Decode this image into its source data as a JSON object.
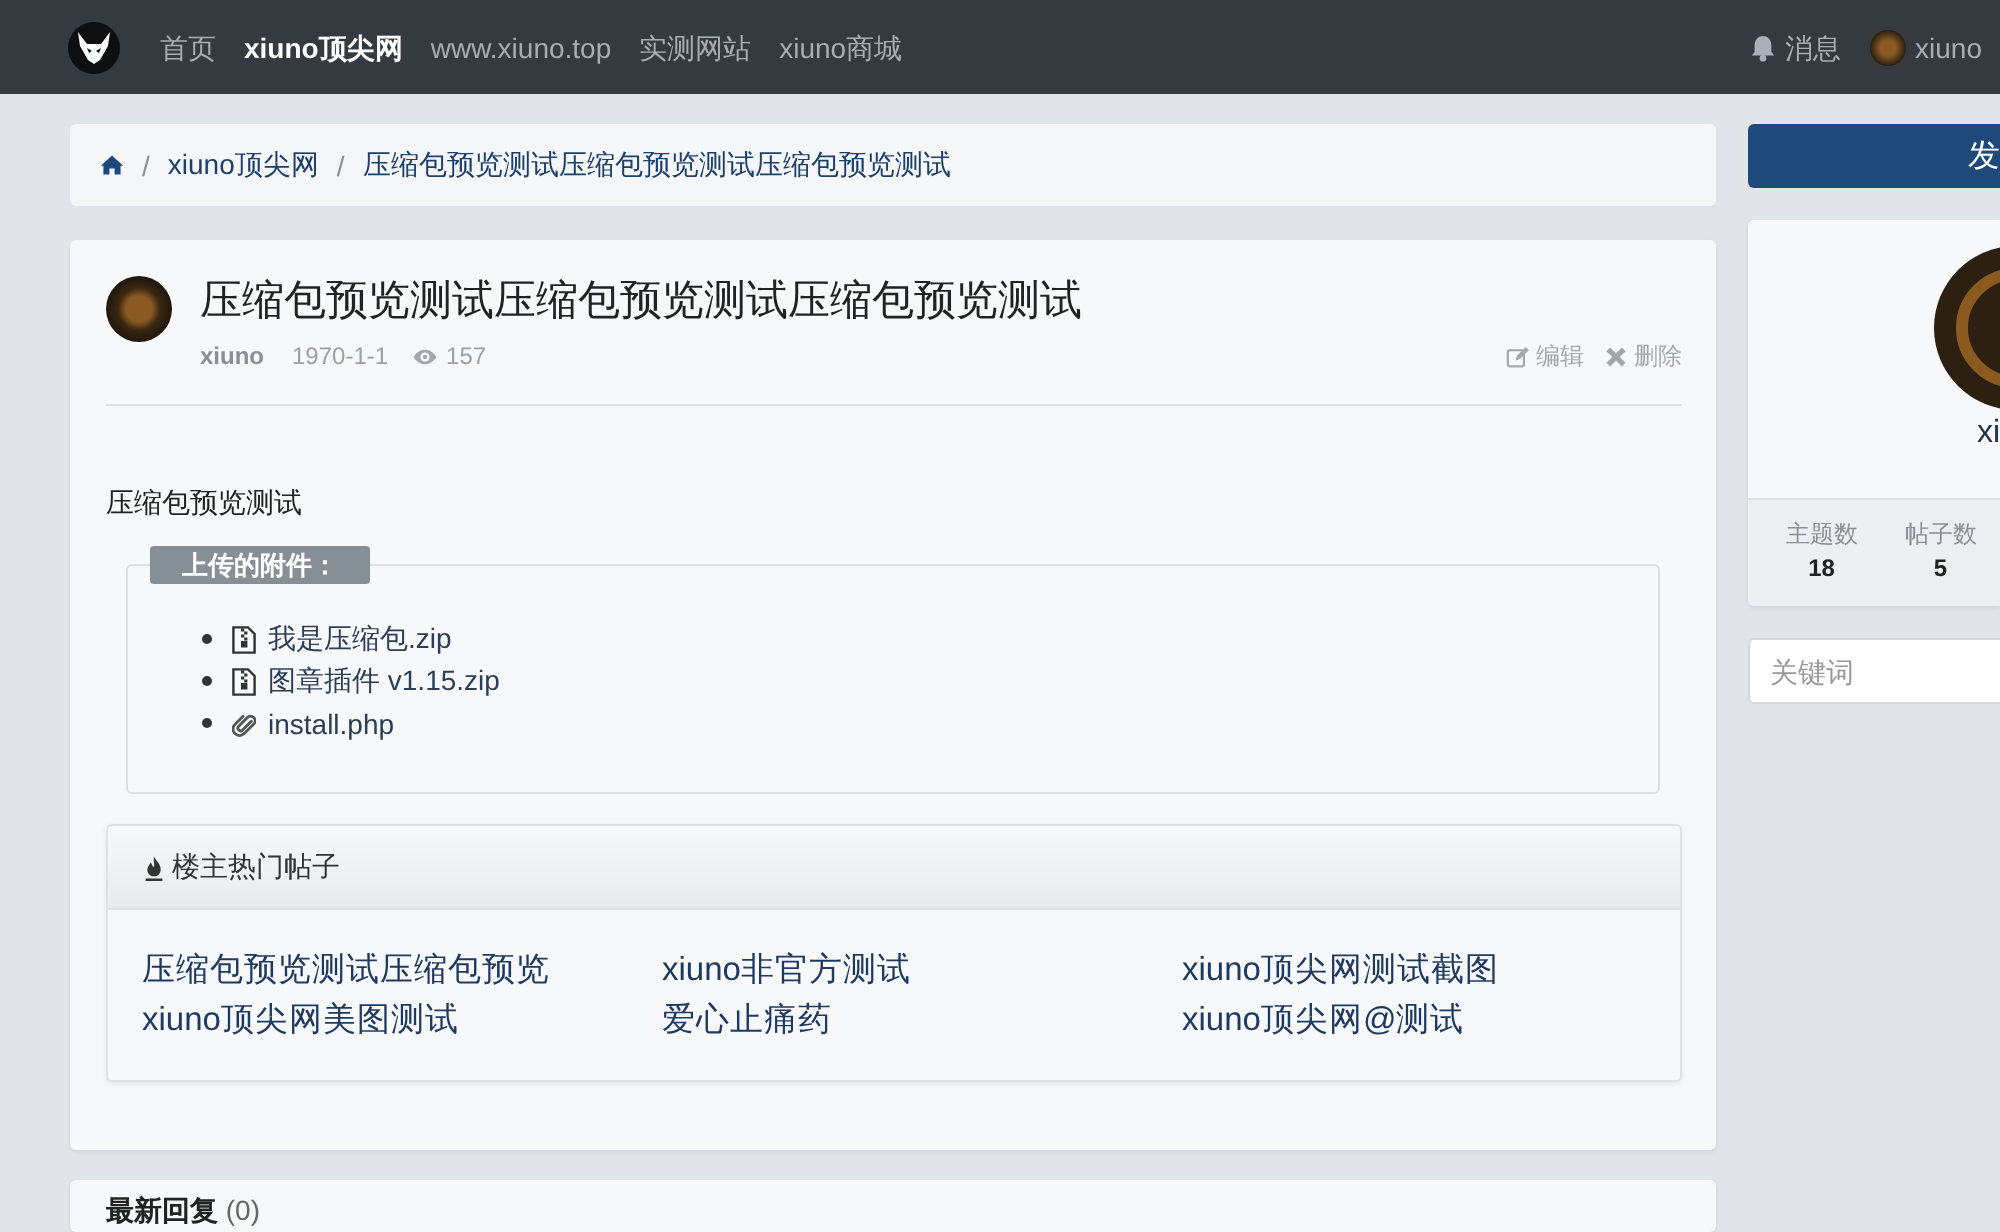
{
  "navbar": {
    "items": [
      {
        "label": "首页",
        "selected": false
      },
      {
        "label": "xiuno顶尖网",
        "selected": true
      },
      {
        "label": "www.xiuno.top",
        "selected": false
      },
      {
        "label": "实测网站",
        "selected": false
      },
      {
        "label": "xiuno商城",
        "selected": false
      }
    ],
    "messages": "消息",
    "user": "xiuno"
  },
  "breadcrumb": {
    "items": [
      {
        "separator": "/",
        "label": "xiuno顶尖网"
      },
      {
        "separator": "/",
        "label": "压缩包预览测试压缩包预览测试压缩包预览测试"
      }
    ]
  },
  "post": {
    "title": "压缩包预览测试压缩包预览测试压缩包预览测试",
    "author": "xiuno",
    "date": "1970-1-1",
    "views": "157",
    "actions": [
      {
        "kind": "edit",
        "label": "编辑"
      },
      {
        "kind": "delete",
        "label": "删除"
      }
    ],
    "body": "压缩包预览测试",
    "attachments": {
      "legend": "上传的附件：",
      "files": [
        {
          "kind": "zip",
          "name": "我是压缩包.zip"
        },
        {
          "kind": "zip",
          "name": "图章插件 v1.15.zip"
        },
        {
          "kind": "file",
          "name": "install.php"
        }
      ]
    }
  },
  "hot_posts": {
    "title": "楼主热门帖子",
    "links": [
      "压缩包预览测试压缩包预览",
      "xiuno非官方测试",
      "xiuno顶尖网测试截图",
      "xiuno顶尖网美图测试",
      "爱心止痛药",
      "xiuno顶尖网@测试"
    ]
  },
  "replies": {
    "title": "**最新回复** (0)"
  },
  "sidebar": {
    "post_button": "发",
    "profile": {
      "name": "xi",
      "stats": [
        {
          "label": "主题数",
          "value": "18"
        },
        {
          "label": "帖子数",
          "value": "5"
        }
      ]
    },
    "search": {
      "placeholder": "关键词"
    }
  }
}
